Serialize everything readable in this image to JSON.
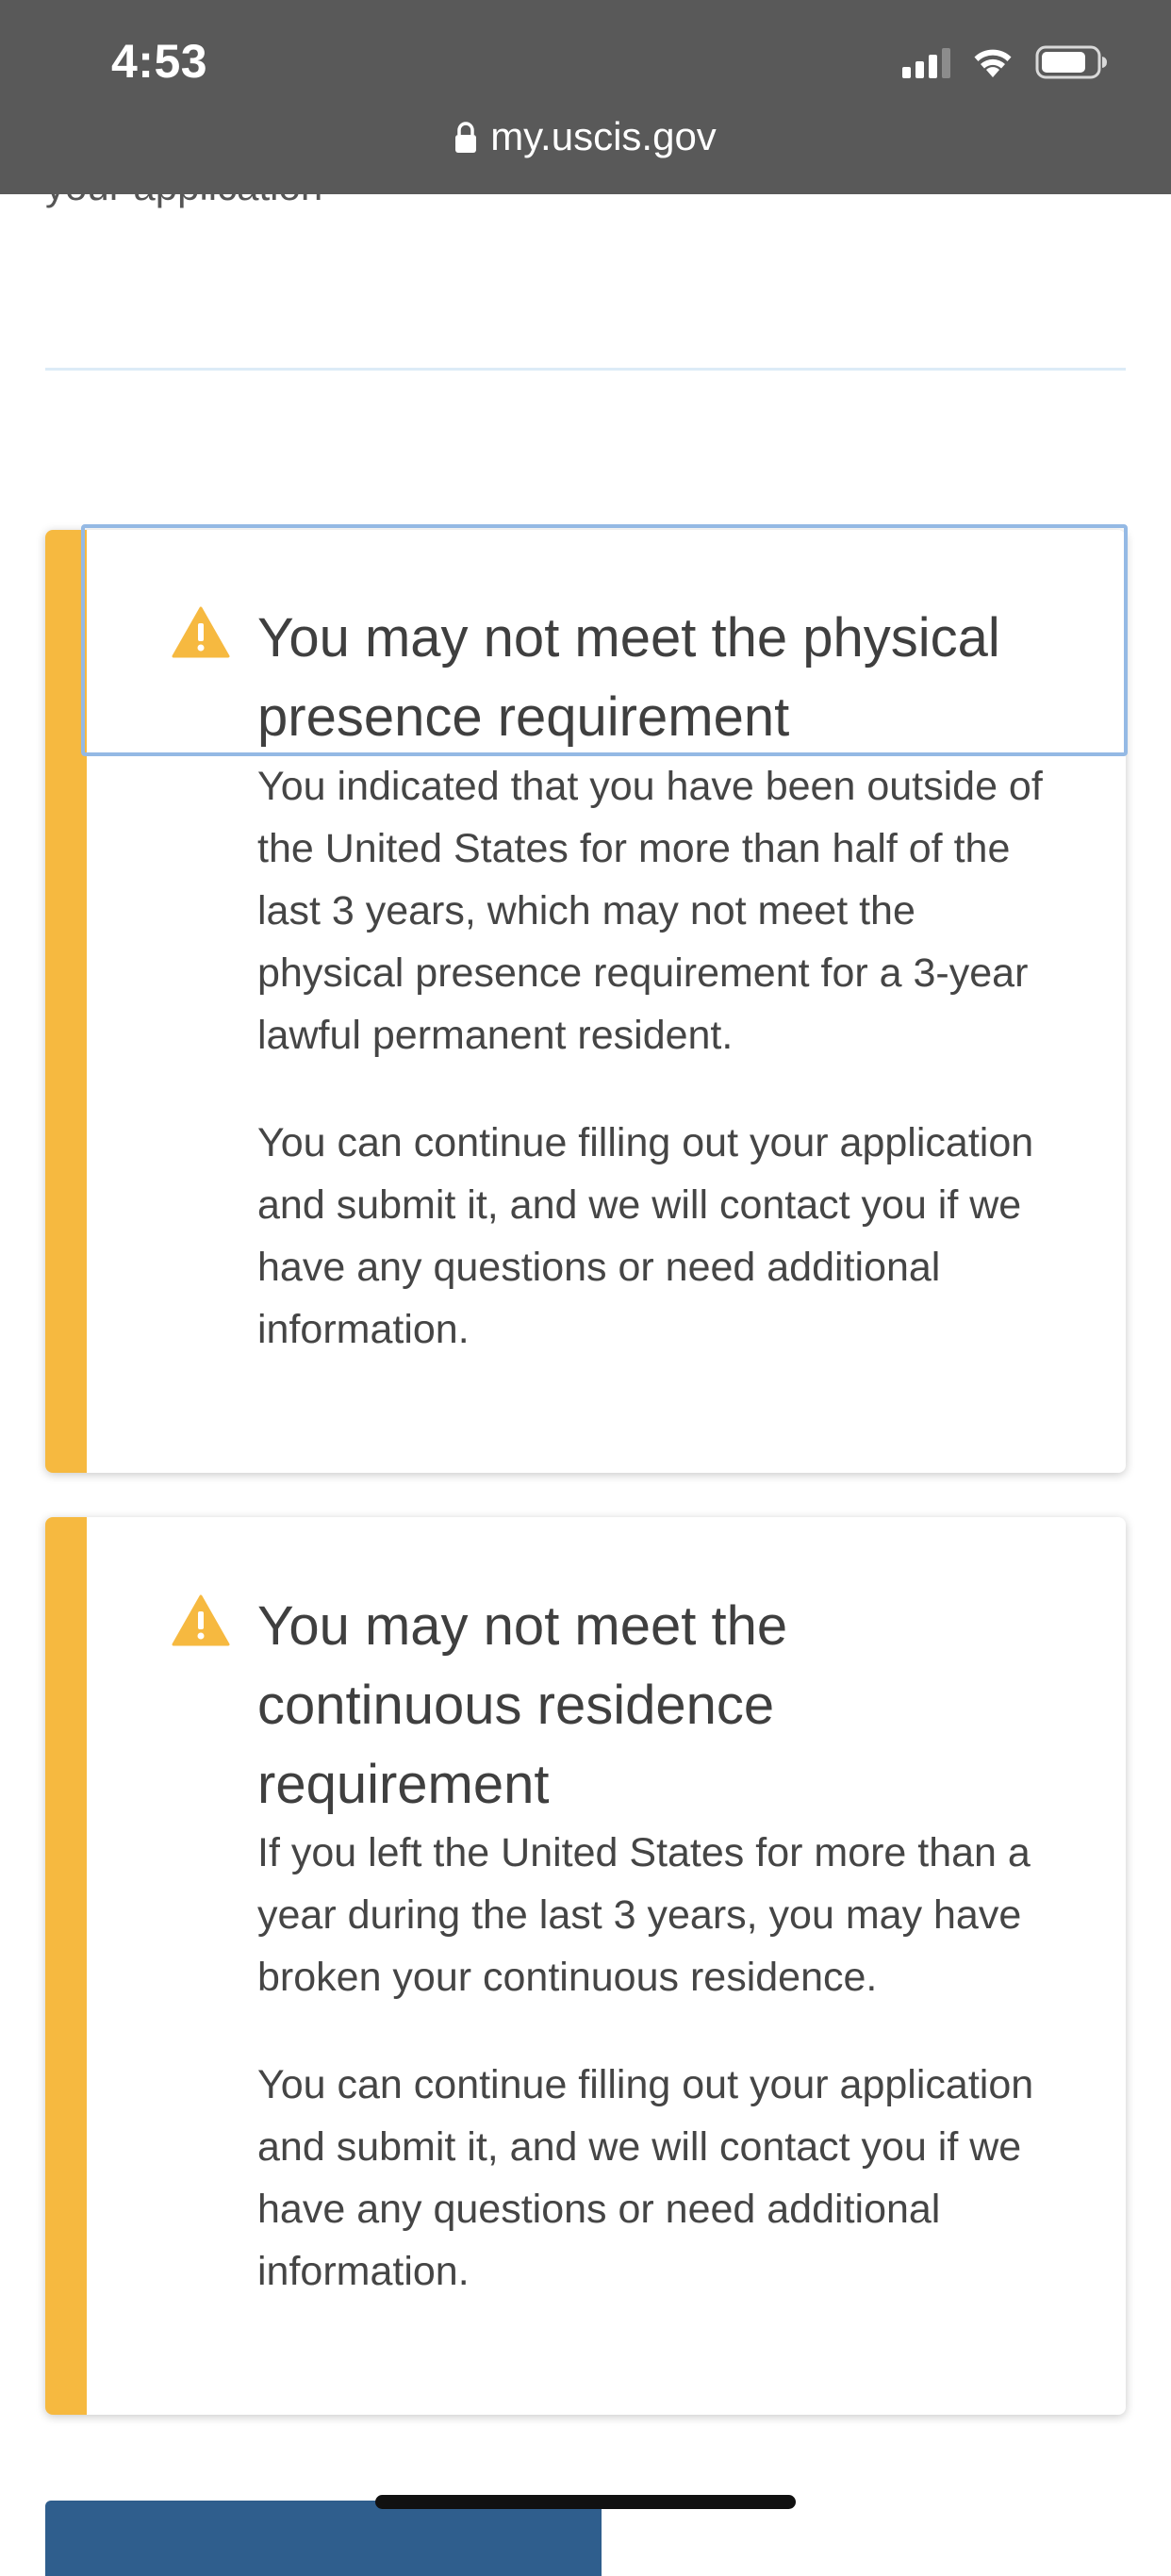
{
  "status_bar": {
    "time": "4:53",
    "url": "my.uscis.gov",
    "icons": [
      "signal-icon",
      "wifi-icon",
      "battery-icon",
      "lock-icon"
    ]
  },
  "page": {
    "cut_off_text": "your application"
  },
  "alerts": [
    {
      "title": "You may not meet the physical presence requirement",
      "paragraphs": [
        "You indicated that you have been outside of the United States for more than half of the last 3 years, which may not meet the physical presence requirement for a 3-year lawful permanent resident.",
        "You can continue filling out your application and submit it, and we will contact you if we have any questions or need additional information."
      ]
    },
    {
      "title": "You may not meet the continuous residence requirement",
      "paragraphs": [
        "If you left the United States for more than a year during the last 3 years, you may have broken your continuous residence.",
        "You can continue filling out your application and submit it, and we will contact you if we have any questions or need additional information."
      ]
    }
  ],
  "colors": {
    "status_bar_bg": "#595959",
    "warning_accent": "#f6b940",
    "focus_ring": "#94b9e4",
    "primary_button": "#2f5e8d",
    "divider": "#dcebf7"
  }
}
